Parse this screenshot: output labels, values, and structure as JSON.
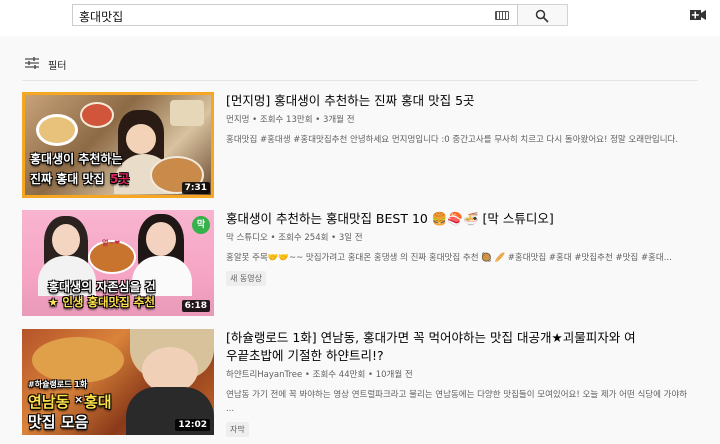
{
  "search": {
    "query": "홍대맛집"
  },
  "filter": {
    "label": "필터"
  },
  "results": [
    {
      "title": "[먼지멍] 홍대생이 추천하는 진짜 홍대 맛집 5곳",
      "channel": "먼지멍",
      "views": "조회수 13만회",
      "age": "3개월 전",
      "description": "홍대맛집 #홍대생 #홍대맛집추천 안녕하세요 먼지멍입니다 :0 중간고사를 무사히 치르고 다시 돌아왔어요! 정말 오래만입니다.",
      "duration": "7:31",
      "thumb_lines": [
        "홍대생이 추천하는",
        "진짜 홍대 맛집",
        "5곳"
      ],
      "badge": ""
    },
    {
      "title": "홍대생이 추천하는 홍대맛집 BEST 10 🍔🍣🍜 [막 스튜디오]",
      "channel": "막 스튜디오",
      "views": "조회수 254회",
      "age": "3일 전",
      "description": "홍알못 주목🤝🤝~~ 맛집가려고 홍대온 홍댕생 의 진짜 홍대맛집 추천 🥘 🥖 #홍대맛집 #홍대 #맛집추천 #맛집 #홍대...",
      "duration": "6:18",
      "thumb_lines": [
        "홍대생의 자존심을 건",
        "★ 인생 홍대맛집 추천"
      ],
      "thumb_badge": "막",
      "thumb_small": "얼~❤",
      "badge": "새 동영상"
    },
    {
      "title": "[하슐랭로드 1화] 연남동, 홍대가면 꼭 먹어야하는 맛집 대공개★괴물피자와 여우끝초밥에 기절한 하얀트리!?",
      "title_line1": "[하슐랭로드 1화] 연남동, 홍대가면 꼭 먹어야하는 맛집 대공개★괴물피자와 여",
      "title_line2": "우끝초밥에 기절한 하얀트리!?",
      "channel": "하얀트리HayanTree",
      "views": "조회수 44만회",
      "age": "10개월 전",
      "description": "연남동 가기 전에 꼭 봐야하는 영상 연트럴파크라고 불리는 연남동에는 다양한 맛집들이 모여있어요! 오늘 제가 어떤 식당에 가야하 ...",
      "duration": "12:02",
      "thumb_lines": [
        "#하슐랭로드 1화",
        "연남동",
        "×",
        "홍대",
        "맛집 모음"
      ],
      "badge": "자막"
    }
  ],
  "colors": {
    "accent_red": "#cc0000",
    "thumb_border_orange": "#f5a623",
    "pink": "#f7a8c8"
  },
  "icons": [
    "keyboard-icon",
    "search-icon",
    "video-camera-icon",
    "filter-icon"
  ]
}
